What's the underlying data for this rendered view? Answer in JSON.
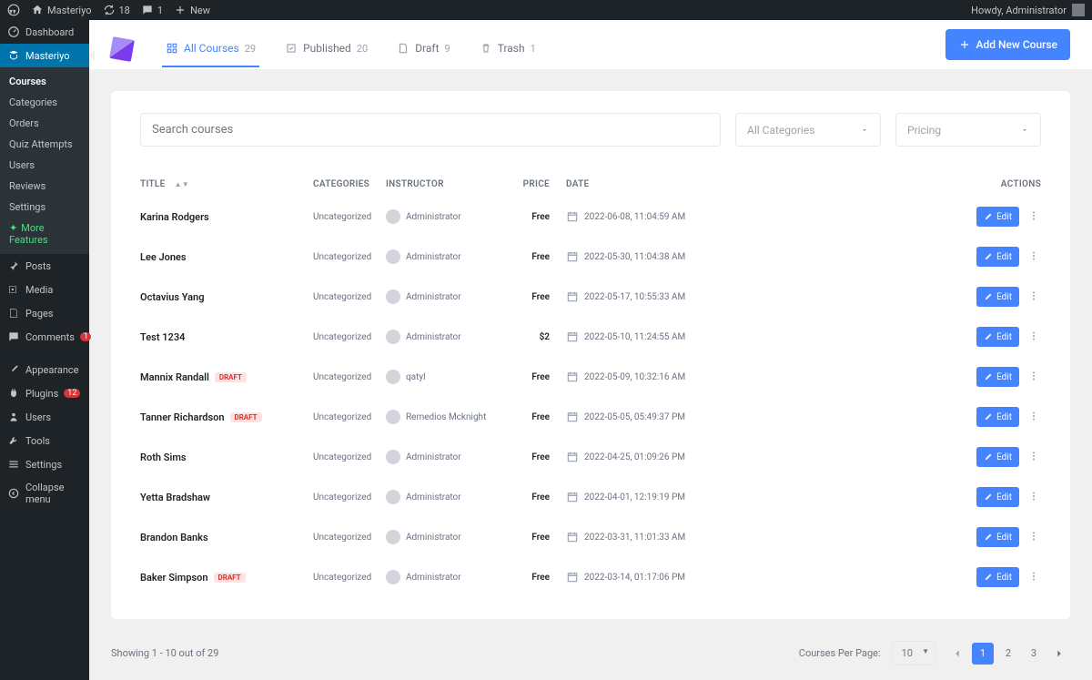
{
  "topbar": {
    "site_name": "Masteriyo",
    "updates_count": "18",
    "comments_count": "1",
    "new_label": "New",
    "howdy": "Howdy, Administrator"
  },
  "sidebar": {
    "items": [
      {
        "label": "Dashboard"
      },
      {
        "label": "Masteriyo"
      }
    ],
    "sub_items": [
      {
        "label": "Courses"
      },
      {
        "label": "Categories"
      },
      {
        "label": "Orders"
      },
      {
        "label": "Quiz Attempts"
      },
      {
        "label": "Users"
      },
      {
        "label": "Reviews"
      },
      {
        "label": "Settings"
      },
      {
        "label": "More Features"
      }
    ],
    "items2": [
      {
        "label": "Posts"
      },
      {
        "label": "Media"
      },
      {
        "label": "Pages"
      },
      {
        "label": "Comments",
        "badge": "1"
      },
      {
        "label": "Appearance"
      },
      {
        "label": "Plugins",
        "badge": "12"
      },
      {
        "label": "Users"
      },
      {
        "label": "Tools"
      },
      {
        "label": "Settings"
      },
      {
        "label": "Collapse menu"
      }
    ]
  },
  "tabs": {
    "all": {
      "label": "All Courses",
      "count": "29"
    },
    "published": {
      "label": "Published",
      "count": "20"
    },
    "draft": {
      "label": "Draft",
      "count": "9"
    },
    "trash": {
      "label": "Trash",
      "count": "1"
    }
  },
  "add_button": "Add New Course",
  "filters": {
    "search_placeholder": "Search courses",
    "categories_label": "All Categories",
    "pricing_label": "Pricing"
  },
  "table": {
    "headers": {
      "title": "TITLE",
      "categories": "CATEGORIES",
      "instructor": "INSTRUCTOR",
      "price": "PRICE",
      "date": "DATE",
      "actions": "ACTIONS"
    },
    "edit_label": "Edit",
    "draft_badge": "DRAFT",
    "rows": [
      {
        "title": "Karina Rodgers",
        "category": "Uncategorized",
        "instructor": "Administrator",
        "price": "Free",
        "date": "2022-06-08, 11:04:59 AM",
        "draft": false
      },
      {
        "title": "Lee Jones",
        "category": "Uncategorized",
        "instructor": "Administrator",
        "price": "Free",
        "date": "2022-05-30, 11:04:38 AM",
        "draft": false
      },
      {
        "title": "Octavius Yang",
        "category": "Uncategorized",
        "instructor": "Administrator",
        "price": "Free",
        "date": "2022-05-17, 10:55:33 AM",
        "draft": false
      },
      {
        "title": "Test 1234",
        "category": "Uncategorized",
        "instructor": "Administrator",
        "price": "$2",
        "date": "2022-05-10, 11:24:55 AM",
        "draft": false
      },
      {
        "title": "Mannix Randall",
        "category": "Uncategorized",
        "instructor": "qatyl",
        "price": "Free",
        "date": "2022-05-09, 10:32:16 AM",
        "draft": true
      },
      {
        "title": "Tanner Richardson",
        "category": "Uncategorized",
        "instructor": "Remedios Mcknight",
        "price": "Free",
        "date": "2022-05-05, 05:49:37 PM",
        "draft": true
      },
      {
        "title": "Roth Sims",
        "category": "Uncategorized",
        "instructor": "Administrator",
        "price": "Free",
        "date": "2022-04-25, 01:09:26 PM",
        "draft": false
      },
      {
        "title": "Yetta Bradshaw",
        "category": "Uncategorized",
        "instructor": "Administrator",
        "price": "Free",
        "date": "2022-04-01, 12:19:19 PM",
        "draft": false
      },
      {
        "title": "Brandon Banks",
        "category": "Uncategorized",
        "instructor": "Administrator",
        "price": "Free",
        "date": "2022-03-31, 11:01:33 AM",
        "draft": false
      },
      {
        "title": "Baker Simpson",
        "category": "Uncategorized",
        "instructor": "Administrator",
        "price": "Free",
        "date": "2022-03-14, 01:17:06 PM",
        "draft": true
      }
    ]
  },
  "footer": {
    "showing": "Showing 1 - 10 out of 29",
    "per_page_label": "Courses Per Page:",
    "per_page_value": "10",
    "pages": [
      "1",
      "2",
      "3"
    ]
  }
}
